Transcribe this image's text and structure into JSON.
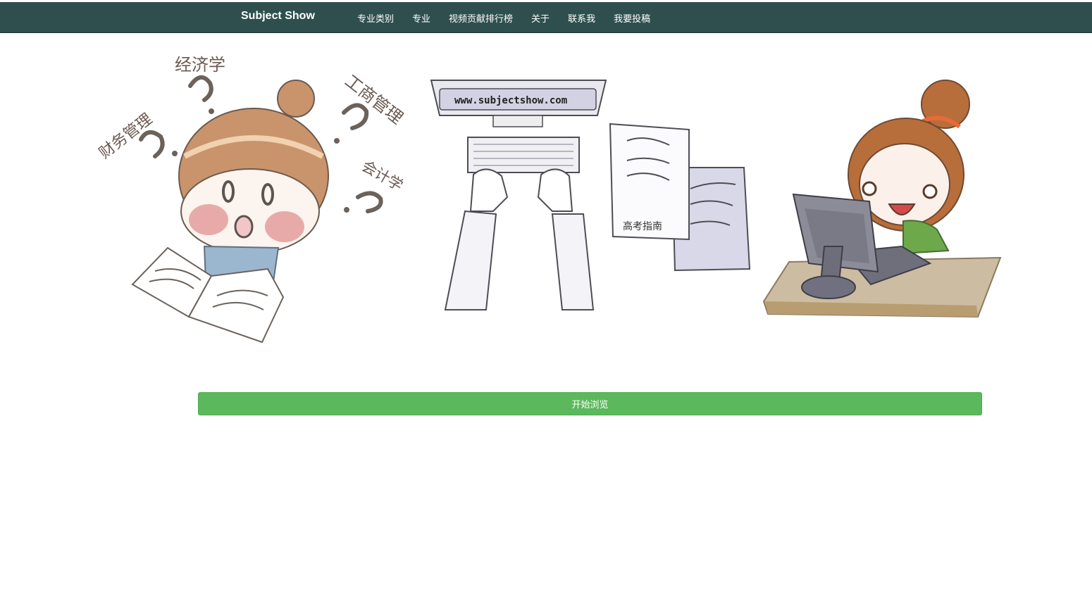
{
  "nav": {
    "brand": "Subject Show",
    "items": [
      "专业类别",
      "专业",
      "视频贡献排行榜",
      "关于",
      "联系我",
      "我要投稿"
    ]
  },
  "hero": {
    "questions": [
      "经济学",
      "财务管理",
      "工商管理",
      "会计学"
    ],
    "monitor_text": "www.subjectshow.com",
    "notebook_text": "高考指南"
  },
  "cta": {
    "label": "开始浏览"
  },
  "colors": {
    "navbar": "#2f4f4f",
    "button": "#5cb85c"
  }
}
